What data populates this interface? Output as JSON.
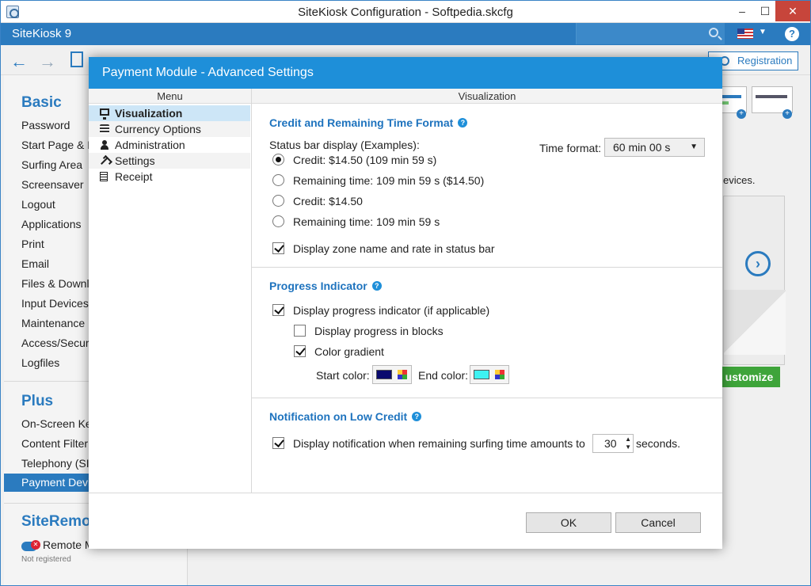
{
  "window": {
    "title": "SiteKiosk Configuration - Softpedia.skcfg",
    "minimize": "–",
    "maximize": "☐",
    "close": "✕"
  },
  "appbar": {
    "name": "SiteKiosk 9",
    "help": "?"
  },
  "toolbar": {
    "back": "←",
    "forward": "→",
    "registration": "Registration"
  },
  "nav": {
    "basic": "Basic",
    "basic_items": [
      "Password",
      "Start Page & B",
      "Surfing Area",
      "Screensaver",
      "Logout",
      "Applications",
      "Print",
      "Email",
      "Files & Downl",
      "Input Devices",
      "Maintenance",
      "Access/Securi",
      "Logfiles"
    ],
    "plus": "Plus",
    "plus_items": [
      "On-Screen Ke",
      "Content Filter",
      "Telephony (SI",
      "Payment Devi"
    ],
    "remote": "SiteRemot",
    "remote_item": "Remote M",
    "not_registered": "Not registered"
  },
  "background": {
    "devices_text": "evices.",
    "customize": "ustomize",
    "next": "›"
  },
  "dialog": {
    "title": "Payment Module - Advanced Settings",
    "menu_header": "Menu",
    "menu_items": [
      {
        "label": "Visualization",
        "icon": "monitor-icon"
      },
      {
        "label": "Currency Options",
        "icon": "coins-icon"
      },
      {
        "label": "Administration",
        "icon": "person-icon"
      },
      {
        "label": "Settings",
        "icon": "wrench-icon"
      },
      {
        "label": "Receipt",
        "icon": "receipt-icon"
      }
    ],
    "content_header": "Visualization",
    "credit_section": {
      "title": "Credit and Remaining Time Format",
      "status_bar_label": "Status bar display (Examples):",
      "time_format_label": "Time format:",
      "time_format_value": "60 min 00 s",
      "options": [
        "Credit: $14.50 (109 min 59 s)",
        "Remaining time: 109 min 59 s ($14.50)",
        "Credit: $14.50",
        "Remaining time: 109 min 59 s"
      ],
      "selected_option": 0,
      "zone_checkbox": "Display zone name and rate in status bar"
    },
    "progress_section": {
      "title": "Progress Indicator",
      "display_progress": "Display progress indicator (if applicable)",
      "blocks": "Display progress in blocks",
      "gradient": "Color gradient",
      "start_color_label": "Start color:",
      "end_color_label": "End color:",
      "start_color": "#0a0a6e",
      "end_color": "#3ef2f2"
    },
    "notification_section": {
      "title": "Notification on Low Credit",
      "checkbox_label": "Display notification when remaining surfing time amounts to",
      "value": "30",
      "suffix": "seconds."
    },
    "ok": "OK",
    "cancel": "Cancel"
  },
  "colors": {
    "accent": "#2b7bbf",
    "dialog_title": "#1e8fd9",
    "section_title": "#1e73be",
    "customize": "#3ea43a"
  }
}
